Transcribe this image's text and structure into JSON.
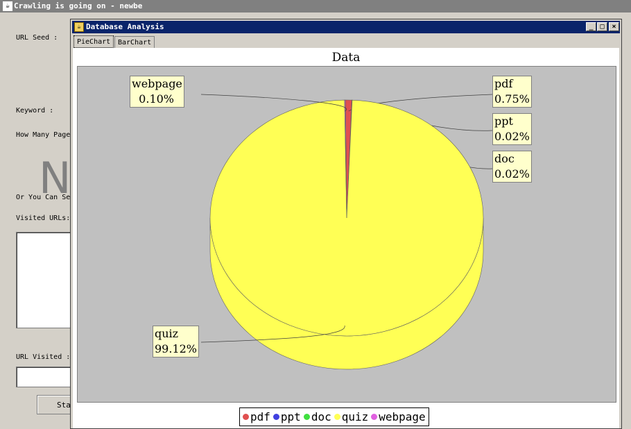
{
  "background_window": {
    "title": "Crawling is going on - newbe",
    "labels": {
      "url_seed": "URL Seed :",
      "keyword": "Keyword :",
      "how_many": "How Many Page",
      "big_letter": "N",
      "or_you_can": "Or You Can Se",
      "visited_urls": "Visited URLs:",
      "url_visited": "URL Visited :"
    },
    "button_label": "Sta"
  },
  "dialog": {
    "title": "Database Analysis",
    "tabs": [
      {
        "label": "PieChart",
        "active": true
      },
      {
        "label": "BarChart",
        "active": false
      }
    ],
    "window_buttons": {
      "minimize": "_",
      "maximize": "□",
      "close": "×"
    }
  },
  "chart_data": {
    "type": "pie",
    "title": "Data",
    "slices": [
      {
        "name": "pdf",
        "value": 0.75,
        "label": "pdf\n0.75%",
        "color": "#e05050"
      },
      {
        "name": "ppt",
        "value": 0.02,
        "label": "ppt\n0.02%",
        "color": "#4040e0"
      },
      {
        "name": "doc",
        "value": 0.02,
        "label": "doc\n0.02%",
        "color": "#40e040"
      },
      {
        "name": "quiz",
        "value": 99.12,
        "label": "quiz\n99.12%",
        "color": "#ffff55"
      },
      {
        "name": "webpage",
        "value": 0.1,
        "label": "webpage\n  0.10%",
        "color": "#e060e0"
      }
    ],
    "legend": [
      "pdf",
      "ppt",
      "doc",
      "quiz",
      "webpage"
    ],
    "legend_placement": "bottom",
    "style": "3d"
  }
}
